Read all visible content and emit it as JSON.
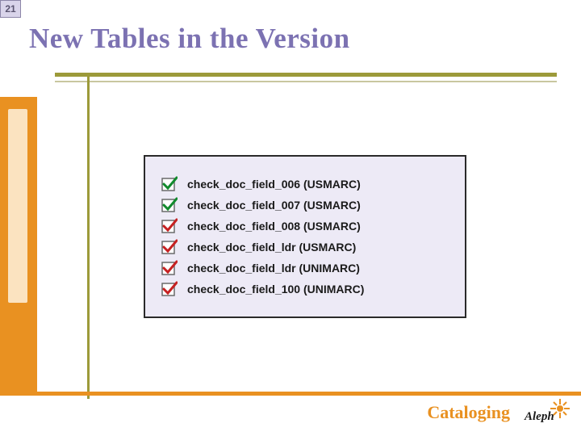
{
  "page_number": "21",
  "title": "New Tables in the Version",
  "items": [
    {
      "label": "check_doc_field_006 (USMARC)"
    },
    {
      "label": "check_doc_field_007 (USMARC)"
    },
    {
      "label": "check_doc_field_008 (USMARC)"
    },
    {
      "label": "check_doc_field_ldr (USMARC)"
    },
    {
      "label": "check_doc_field_ldr (UNIMARC)"
    },
    {
      "label": "check_doc_field_100 (UNIMARC)"
    }
  ],
  "footer": "Cataloging",
  "logo_text": "Aleph",
  "colors": {
    "title": "#7c72b2",
    "accent_orange": "#e99121",
    "olive": "#9c9a3a",
    "box_bg": "#edeaf6",
    "badge_bg": "#d9d4ea",
    "check_green": "#118a2d",
    "check_red": "#c62122"
  }
}
